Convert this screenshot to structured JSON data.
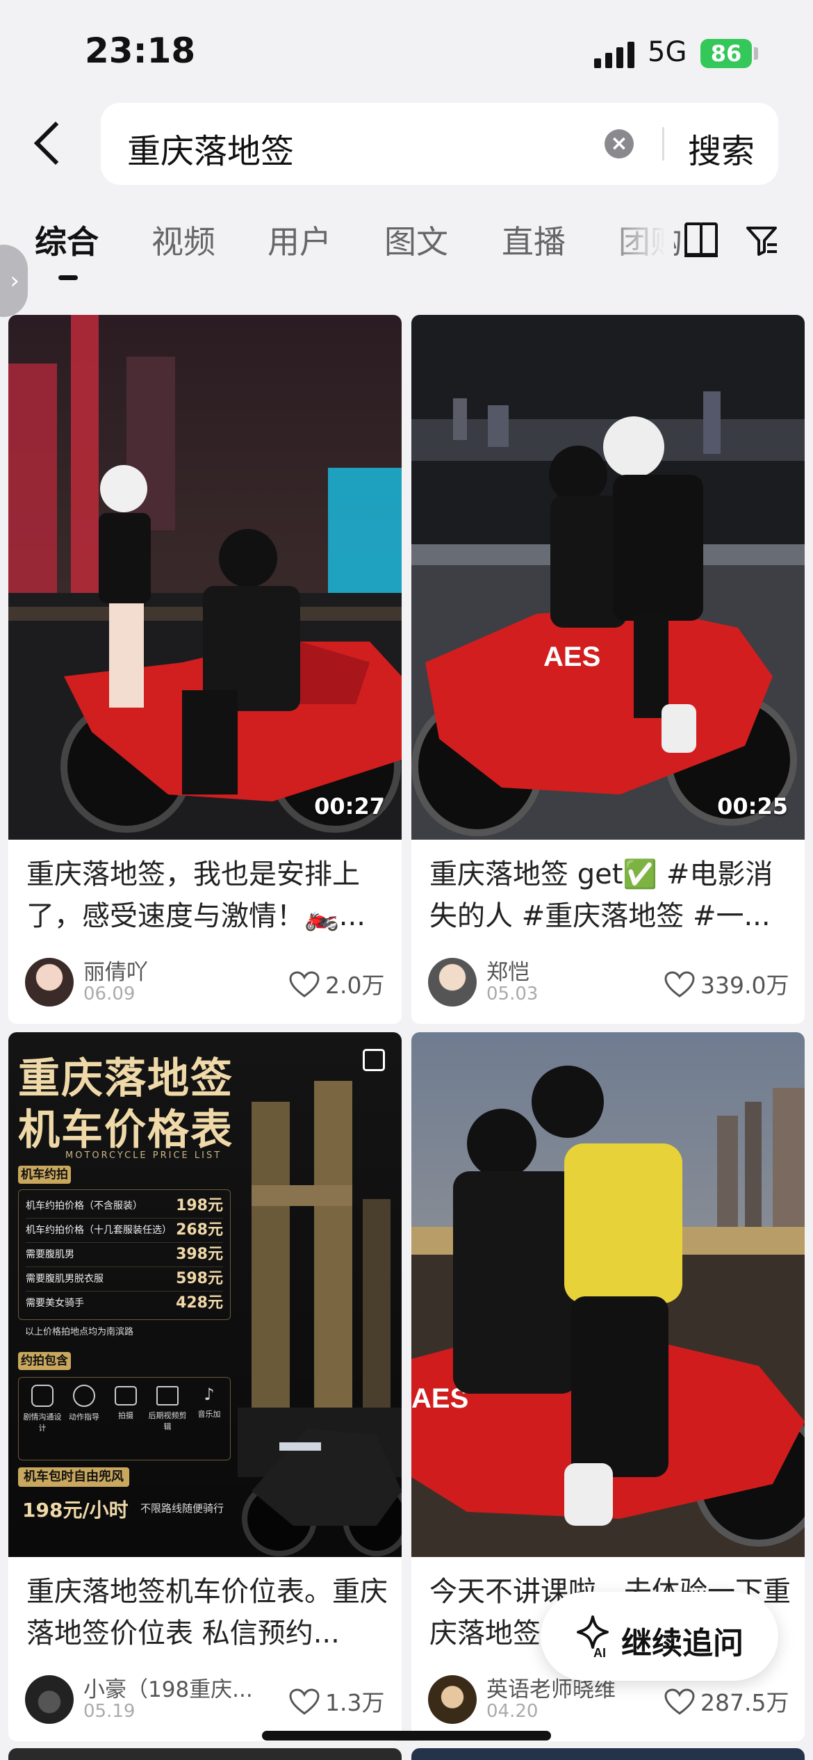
{
  "status_bar": {
    "time": "23:18",
    "network": "5G",
    "battery": "86"
  },
  "search": {
    "query": "重庆落地签",
    "button": "搜索"
  },
  "tabs": [
    {
      "label": "综合",
      "active": true
    },
    {
      "label": "视频"
    },
    {
      "label": "用户"
    },
    {
      "label": "图文"
    },
    {
      "label": "直播"
    },
    {
      "label": "团购"
    }
  ],
  "cards": [
    {
      "duration": "00:27",
      "title": "重庆落地签，我也是安排上了，感受速度与激情！🏍️...",
      "author": "丽倩吖",
      "date": "06.09",
      "likes": "2.0万"
    },
    {
      "duration": "00:25",
      "title": "重庆落地签 get✅ #电影消失的人 #重庆落地签 #一...",
      "author": "郑恺",
      "date": "05.03",
      "likes": "339.0万"
    },
    {
      "title": "重庆落地签机车价位表。重庆落地签价位表 私信预约...",
      "author": "小豪（198重庆...",
      "date": "05.19",
      "likes": "1.3万",
      "poster": {
        "title_line1": "重庆落地签",
        "title_line2": "机车价格表",
        "subtitle": "MOTORCYCLE PRICE LIST",
        "section1": "机车约拍",
        "prices": [
          {
            "item": "机车约拍价格（不含服装）",
            "price": "198元"
          },
          {
            "item": "机车约拍价格（十几套服装任选）",
            "price": "268元"
          },
          {
            "item": "需要腹肌男",
            "price": "398元"
          },
          {
            "item": "需要腹肌男脱衣服",
            "price": "598元"
          },
          {
            "item": "需要美女骑手",
            "price": "428元"
          }
        ],
        "note": "以上价格拍地点均为南滨路",
        "section2": "约拍包含",
        "services": [
          "剧情沟通设计",
          "动作指导",
          "拍摄",
          "后期视频剪辑",
          "音乐加"
        ],
        "section3": "机车包时自由兜风",
        "hourly": "198元/小时",
        "hourly_note": "不限路线随便骑行"
      }
    },
    {
      "title": "今天不讲课啦，去体验一下重庆落地签",
      "author": "英语老师晓维",
      "date": "04.20",
      "likes": "287.5万"
    }
  ],
  "float_button": {
    "label": "继续追问",
    "icon": "ai-sparkle-icon"
  }
}
